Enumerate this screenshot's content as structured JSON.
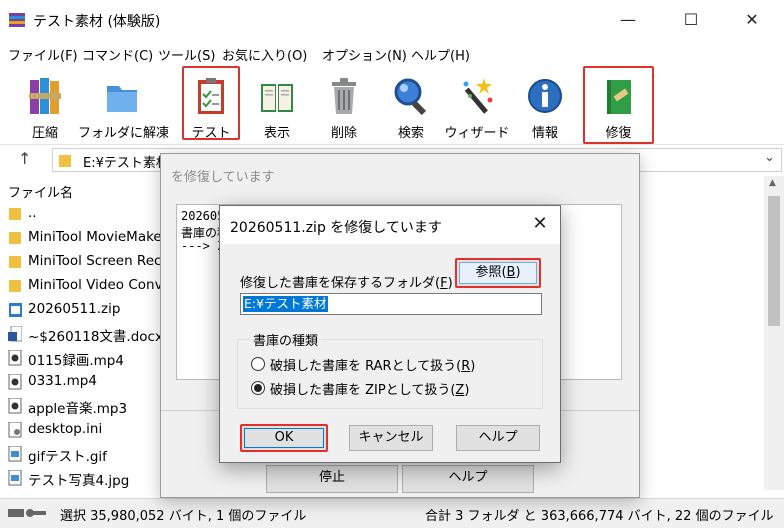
{
  "window": {
    "title": "テスト素材 (体験版)"
  },
  "window_controls": {
    "minimize": "—",
    "maximize": "☐",
    "close": "✕"
  },
  "menu": [
    "ファイル(F)",
    "コマンド(C)",
    "ツール(S)",
    "お気に入り(O)",
    "オプション(N)",
    "ヘルプ(H)"
  ],
  "toolbar": {
    "add": "圧縮",
    "extract": "フォルダに解凍",
    "test": "テスト",
    "view": "表示",
    "delete": "削除",
    "find": "検索",
    "wizard": "ウィザード",
    "info": "情報",
    "repair": "修復"
  },
  "address": {
    "up": "↑",
    "path": "E:¥テスト素材"
  },
  "filelist": {
    "header": "ファイル名",
    "items": [
      "..",
      "MiniTool MovieMaker",
      "MiniTool Screen Recorder",
      "MiniTool Video Converter",
      "20260511.zip",
      "~$260118文書.docx",
      "0115録画.mp4",
      "0331.mp4",
      "apple音楽.mp3",
      "desktop.ini",
      "gifテスト.gif",
      "テスト写真4.jpg"
    ]
  },
  "status": {
    "left": "選択 35,980,052 バイト, 1 個のファイル",
    "right": "合計 3 フォルダ と 363,666,774 バイト, 22 個のファイル"
  },
  "bg_window": {
    "title": "を修復しています",
    "log": [
      "202605",
      "書庫の種",
      "---> ZIP"
    ],
    "stop": "停止",
    "help": "ヘルプ"
  },
  "dialog": {
    "title": "20260511.zip を修復しています",
    "folder_label": "修復した書庫を保存するフォルダ(",
    "folder_key": "F",
    "browse_label": "参照(",
    "browse_key": "B",
    "folder_value": "E:¥テスト素材",
    "group_label": "書庫の種類",
    "option_rar": "破損した書庫を RARとして扱う(",
    "option_rar_key": "R",
    "option_zip": "破損した書庫を ZIPとして扱う(",
    "option_zip_key": "Z",
    "selected": "zip",
    "ok": "OK",
    "cancel": "キャンセル",
    "help": "ヘルプ"
  },
  "colors": {
    "highlight_box": "#e0312f",
    "selection": "#0078d7"
  }
}
